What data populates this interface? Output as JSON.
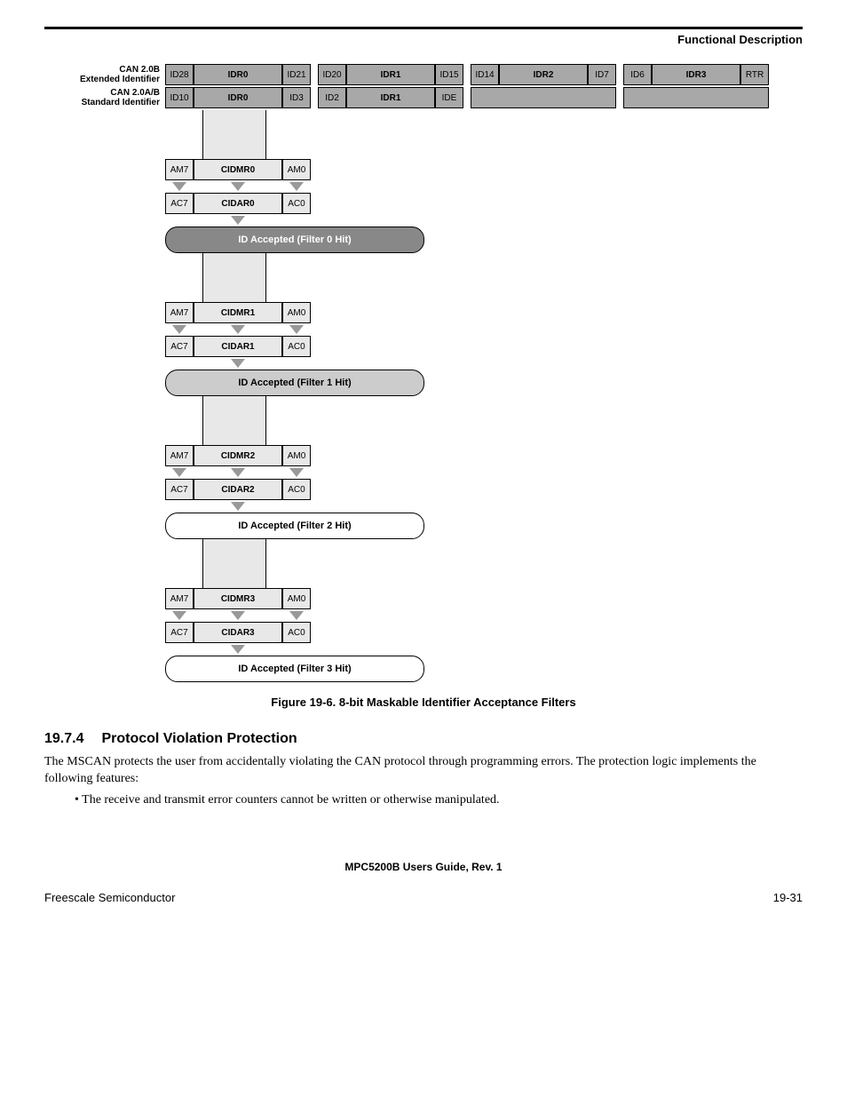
{
  "header": {
    "title": "Functional Description"
  },
  "top_rows": [
    {
      "label": "CAN 2.0B\nExtended Identifier",
      "blocks": [
        {
          "left": "ID28",
          "mid": "IDR0",
          "right": "ID21",
          "bg": "gray"
        },
        {
          "left": "ID20",
          "mid": "IDR1",
          "right": "ID15",
          "bg": "gray"
        },
        {
          "left": "ID14",
          "mid": "IDR2",
          "right": "ID7",
          "bg": "gray"
        },
        {
          "left": "ID6",
          "mid": "IDR3",
          "right": "RTR",
          "bg": "gray"
        }
      ],
      "sep": true
    },
    {
      "label": "CAN 2.0A/B\nStandard Identifier",
      "blocks": [
        {
          "left": "ID10",
          "mid": "IDR0",
          "right": "ID3",
          "bg": "gray"
        },
        {
          "left": "ID2",
          "mid": "IDR1",
          "right": "IDE",
          "bg": "gray"
        },
        {
          "left": "",
          "mid": "",
          "right": "",
          "bg": "gray",
          "empty": true
        },
        {
          "left": "",
          "mid": "",
          "right": "",
          "bg": "gray",
          "empty": true
        }
      ],
      "sep": true
    }
  ],
  "filters": [
    {
      "mask": {
        "left": "AM7",
        "mid": "CIDMR0",
        "right": "AM0"
      },
      "acc": {
        "left": "AC7",
        "mid": "CIDAR0",
        "right": "AC0"
      },
      "pill": "ID Accepted (Filter 0 Hit)",
      "pill_bg": "gray"
    },
    {
      "mask": {
        "left": "AM7",
        "mid": "CIDMR1",
        "right": "AM0"
      },
      "acc": {
        "left": "AC7",
        "mid": "CIDAR1",
        "right": "AC0"
      },
      "pill": "ID Accepted (Filter 1 Hit)",
      "pill_bg": "light"
    },
    {
      "mask": {
        "left": "AM7",
        "mid": "CIDMR2",
        "right": "AM0"
      },
      "acc": {
        "left": "AC7",
        "mid": "CIDAR2",
        "right": "AC0"
      },
      "pill": "ID Accepted (Filter 2 Hit)",
      "pill_bg": "white"
    },
    {
      "mask": {
        "left": "AM7",
        "mid": "CIDMR3",
        "right": "AM0"
      },
      "acc": {
        "left": "AC7",
        "mid": "CIDAR3",
        "right": "AC0"
      },
      "pill": "ID Accepted (Filter 3 Hit)",
      "pill_bg": "white"
    }
  ],
  "figure_caption": "Figure 19-6. 8-bit Maskable Identifier Acceptance Filters",
  "section": {
    "number": "19.7.4",
    "title": "Protocol Violation Protection",
    "para": "The MSCAN protects the user from accidentally violating the CAN protocol through programming errors. The protection logic implements the following features:",
    "bullet1": "The receive and transmit error counters cannot be written or otherwise manipulated."
  },
  "footer": {
    "center": "MPC5200B Users Guide, Rev. 1",
    "left": "Freescale Semiconductor",
    "right": "19-31"
  }
}
